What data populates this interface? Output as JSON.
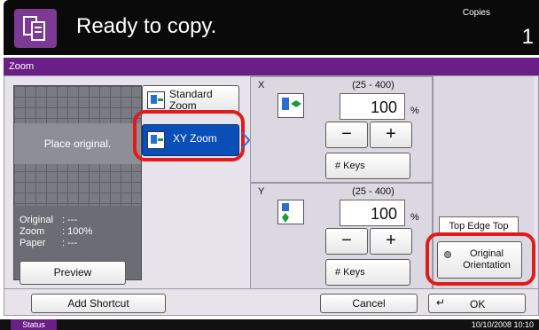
{
  "title": "Ready to copy.",
  "copies": {
    "label": "Copies",
    "value": "1"
  },
  "panel_title": "Zoom",
  "preview": {
    "message": "Place original.",
    "info": [
      {
        "key": "Original",
        "value": ": ---"
      },
      {
        "key": "Zoom",
        "value": ": 100%"
      },
      {
        "key": "Paper",
        "value": ": ---"
      }
    ],
    "button": "Preview"
  },
  "zoom_modes": {
    "standard": "Standard Zoom",
    "xy": "XY Zoom",
    "selected": "xy"
  },
  "x_axis": {
    "letter": "X",
    "range": "(25 - 400)",
    "value": "100",
    "unit": "%",
    "minus": "−",
    "plus": "+",
    "keys": "# Keys"
  },
  "y_axis": {
    "letter": "Y",
    "range": "(25 - 400)",
    "value": "100",
    "unit": "%",
    "minus": "−",
    "plus": "+",
    "keys": "# Keys"
  },
  "orientation": {
    "current": "Top Edge Top",
    "button": "Original Orientation"
  },
  "footer": {
    "add_shortcut": "Add Shortcut",
    "cancel": "Cancel",
    "ok": "OK"
  },
  "statusbar": {
    "status": "Status",
    "datetime": "10/10/2008   10:10"
  },
  "colors": {
    "accent": "#6a1f86",
    "selected": "#0a4fb8",
    "highlight": "#e01b1b"
  }
}
